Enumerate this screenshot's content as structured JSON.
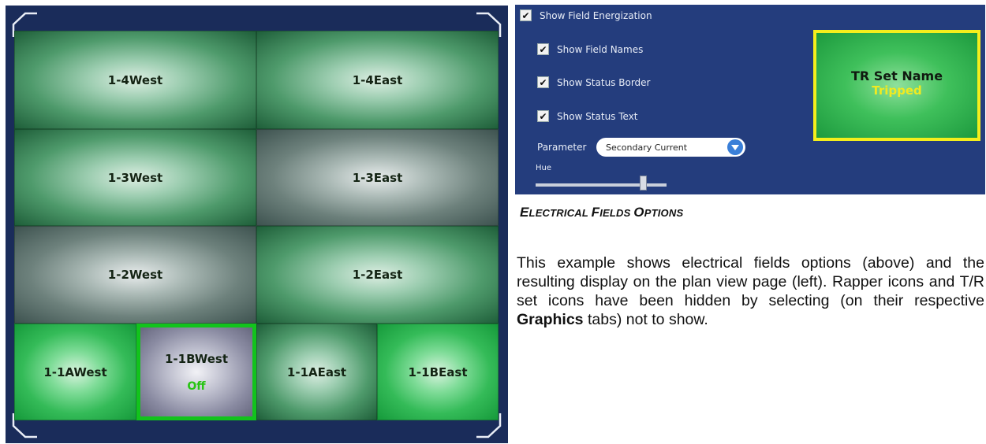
{
  "plan_view": {
    "fields": [
      {
        "name": "1-4West",
        "status": "",
        "state": "energized"
      },
      {
        "name": "1-4East",
        "status": "",
        "state": "energized"
      },
      {
        "name": "1-3West",
        "status": "",
        "state": "energized"
      },
      {
        "name": "1-3East",
        "status": "",
        "state": "partial"
      },
      {
        "name": "1-2West",
        "status": "",
        "state": "partial"
      },
      {
        "name": "1-2East",
        "status": "",
        "state": "energized"
      },
      {
        "name": "1-1AWest",
        "status": "",
        "state": "bright"
      },
      {
        "name": "1-1BWest",
        "status": "Off",
        "state": "off"
      },
      {
        "name": "1-1AEast",
        "status": "",
        "state": "energized"
      },
      {
        "name": "1-1BEast",
        "status": "",
        "state": "bright"
      }
    ]
  },
  "options": {
    "show_field_energization": {
      "label": "Show Field Energization",
      "checked": true
    },
    "show_field_names": {
      "label": "Show Field Names",
      "checked": true
    },
    "show_status_border": {
      "label": "Show Status Border",
      "checked": true
    },
    "show_status_text": {
      "label": "Show Status Text",
      "checked": true
    },
    "parameter_label": "Parameter",
    "parameter_value": "Secondary Current",
    "hue_label": "Hue",
    "hue_value": 0.82,
    "preview": {
      "name": "TR Set Name",
      "status": "Tripped"
    },
    "check_mark": "✔"
  },
  "caption": {
    "first": "E",
    "rest1": "LECTRICAL ",
    "second": "F",
    "rest2": "IELDS ",
    "third": "O",
    "rest3": "PTIONS"
  },
  "description": {
    "part1": "This example shows electrical fields options (above) and the resulting display on the plan view page (left). Rapper icons and T/R set icons have been hidden by selecting (on their respective ",
    "bold": "Graphics",
    "part2": " tabs) not to show."
  },
  "colors": {
    "panel_bg": "#243d7d",
    "plan_bg": "#1a2c5a",
    "status_border": "#12c31c",
    "preview_border": "#f4ee1c",
    "tripped_text": "#f0ea20"
  }
}
